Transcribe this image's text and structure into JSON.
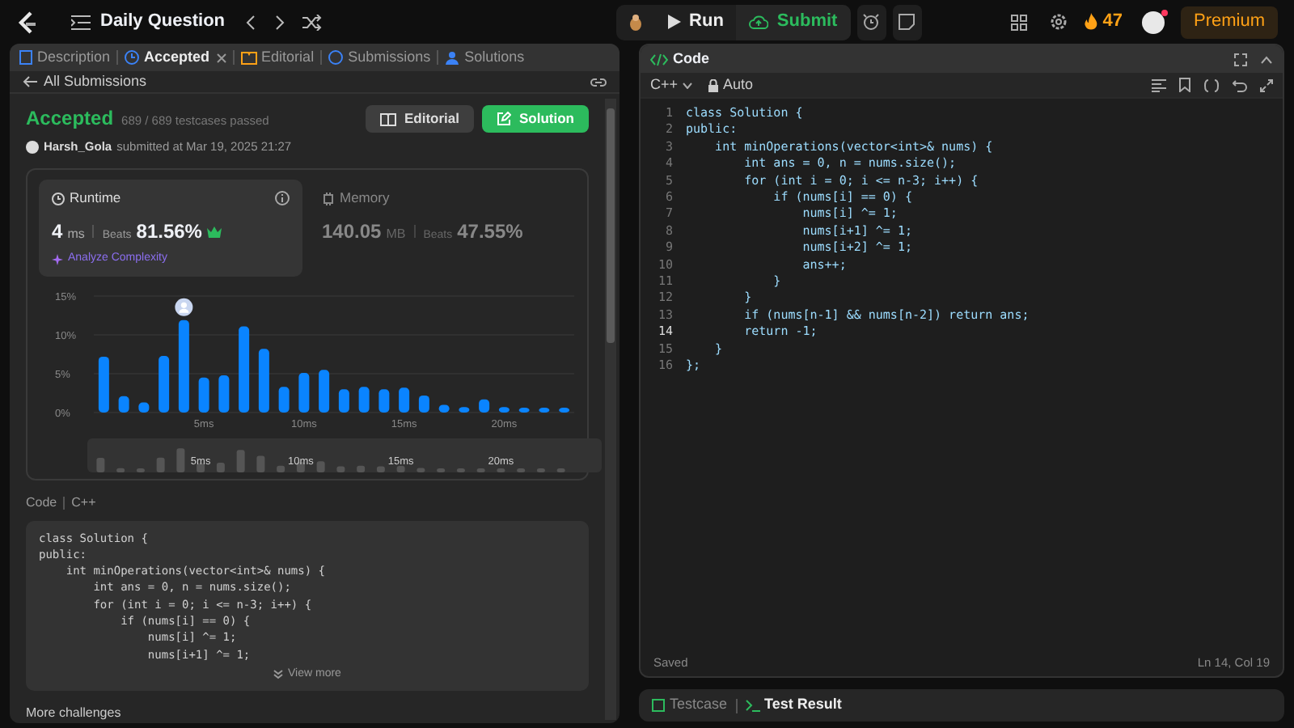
{
  "top_bar": {
    "title": "Daily Question",
    "run": "Run",
    "submit": "Submit",
    "streak": "47",
    "premium": "Premium"
  },
  "left_panel": {
    "tabs": [
      {
        "label": "Description",
        "selected": false,
        "closable": false
      },
      {
        "label": "Accepted",
        "selected": true,
        "closable": true
      },
      {
        "label": "Editorial",
        "selected": false,
        "closable": false
      },
      {
        "label": "Submissions",
        "selected": false,
        "closable": false
      },
      {
        "label": "Solutions",
        "selected": false,
        "closable": false
      }
    ],
    "back_link": "All Submissions",
    "status": "Accepted",
    "testcases": "689 / 689 testcases passed",
    "user": "Harsh_Gola",
    "submitted": "submitted at Mar 19, 2025 21:27",
    "buttons": [
      {
        "label": "Editorial",
        "kind": "secondary"
      },
      {
        "label": "Solution",
        "kind": "primary"
      }
    ],
    "runtime": {
      "title": "Runtime",
      "value": "4",
      "unit": "ms",
      "beats_label": "Beats",
      "beats": "81.56%",
      "analyze": "Analyze Complexity"
    },
    "memory": {
      "title": "Memory",
      "value": "140.05",
      "unit": "MB",
      "beats_label": "Beats",
      "beats": "47.55%"
    },
    "chart_data": {
      "type": "bar",
      "x": [
        0,
        1,
        2,
        3,
        4,
        5,
        6,
        7,
        8,
        9,
        10,
        11,
        12,
        13,
        14,
        15,
        16,
        17,
        18,
        19,
        20,
        21,
        22,
        23
      ],
      "xlim": [
        -0.5,
        23.5
      ],
      "series": [
        {
          "color": "#0a84ff",
          "values": [
            7.2,
            2.1,
            1.3,
            7.3,
            11.9,
            4.5,
            4.8,
            11.1,
            8.2,
            3.3,
            5.1,
            5.5,
            3.0,
            3.3,
            3.0,
            3.2,
            2.2,
            1.0,
            0.7,
            1.7,
            0.7,
            0.4,
            0.4,
            0.4
          ]
        }
      ],
      "ylim": [
        0,
        15
      ],
      "yticks": [
        {
          "value": 0,
          "label": "0%"
        },
        {
          "value": 5,
          "label": "5%"
        },
        {
          "value": 10,
          "label": "10%"
        },
        {
          "value": 15,
          "label": "15%"
        }
      ],
      "xticks": [
        {
          "value": 5,
          "label": "5ms"
        },
        {
          "value": 10,
          "label": "10ms"
        },
        {
          "value": 15,
          "label": "15ms"
        },
        {
          "value": 20,
          "label": "20ms"
        }
      ]
    },
    "range_slider": {
      "labels": [
        "5ms",
        "10ms",
        "15ms",
        "20ms"
      ]
    },
    "code_header": {
      "label": "Code",
      "language": "C++"
    },
    "code_preview": [
      "class Solution {",
      "public:",
      "    int minOperations(vector<int>& nums) {",
      "        int ans = 0, n = nums.size();",
      "        for (int i = 0; i <= n-3; i++) {",
      "            if (nums[i] == 0) {",
      "                nums[i] ^= 1;",
      "                nums[i+1] ^= 1;"
    ],
    "view_more": "View more",
    "more_challenges": "More challenges"
  },
  "right_panel": {
    "title": "Code",
    "language": "C++",
    "mode": "Auto",
    "lines": [
      {
        "number": "1",
        "text": "class Solution {",
        "current": false
      },
      {
        "number": "2",
        "text": "public:",
        "current": false
      },
      {
        "number": "3",
        "text": "    int minOperations(vector<int>& nums) {",
        "current": false
      },
      {
        "number": "4",
        "text": "        int ans = 0, n = nums.size();",
        "current": false
      },
      {
        "number": "5",
        "text": "        for (int i = 0; i <= n-3; i++) {",
        "current": false
      },
      {
        "number": "6",
        "text": "            if (nums[i] == 0) {",
        "current": false
      },
      {
        "number": "7",
        "text": "                nums[i] ^= 1;",
        "current": false
      },
      {
        "number": "8",
        "text": "                nums[i+1] ^= 1;",
        "current": false
      },
      {
        "number": "9",
        "text": "                nums[i+2] ^= 1;",
        "current": false
      },
      {
        "number": "10",
        "text": "                ans++;",
        "current": false
      },
      {
        "number": "11",
        "text": "            }",
        "current": false
      },
      {
        "number": "12",
        "text": "        }",
        "current": false
      },
      {
        "number": "13",
        "text": "        if (nums[n-1] && nums[n-2]) return ans;",
        "current": false
      },
      {
        "number": "14",
        "text": "        return -1;",
        "current": true
      },
      {
        "number": "15",
        "text": "    }",
        "current": false
      },
      {
        "number": "16",
        "text": "};",
        "current": false
      }
    ],
    "saved": "Saved",
    "cursor": "Ln 14, Col 19"
  },
  "bottom_panel": {
    "tabs": [
      {
        "label": "Testcase",
        "selected": false
      },
      {
        "label": "Test Result",
        "selected": true
      }
    ]
  }
}
